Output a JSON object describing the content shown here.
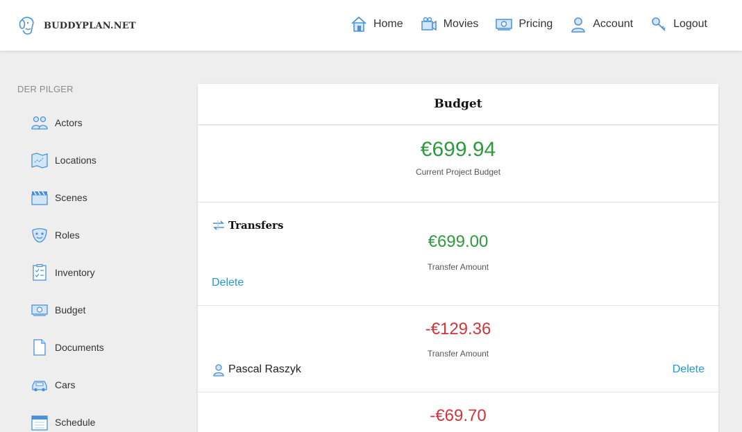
{
  "brand": {
    "name": "BUDDYPLAN.NET"
  },
  "nav": {
    "items": [
      {
        "label": "Home",
        "icon": "home-icon"
      },
      {
        "label": "Movies",
        "icon": "movie-camera-icon"
      },
      {
        "label": "Pricing",
        "icon": "money-icon"
      },
      {
        "label": "Account",
        "icon": "user-icon"
      },
      {
        "label": "Logout",
        "icon": "key-icon"
      }
    ]
  },
  "sidebar": {
    "title": "DER PILGER",
    "items": [
      {
        "label": "Actors",
        "icon": "actors-icon"
      },
      {
        "label": "Locations",
        "icon": "map-icon"
      },
      {
        "label": "Scenes",
        "icon": "clapperboard-icon"
      },
      {
        "label": "Roles",
        "icon": "mask-icon"
      },
      {
        "label": "Inventory",
        "icon": "checklist-icon"
      },
      {
        "label": "Budget",
        "icon": "money-icon"
      },
      {
        "label": "Documents",
        "icon": "document-icon"
      },
      {
        "label": "Cars",
        "icon": "car-icon"
      },
      {
        "label": "Schedule",
        "icon": "calendar-icon"
      }
    ]
  },
  "budget": {
    "title": "Budget",
    "current_amount": "€699.94",
    "current_label": "Current Project Budget",
    "entries": [
      {
        "title": "Transfers",
        "amount": "€699.00",
        "amount_label": "Transfer Amount",
        "delete_label": "Delete"
      },
      {
        "amount": "-€129.36",
        "amount_label": "Transfer Amount",
        "person": "Pascal Raszyk",
        "delete_label": "Delete"
      },
      {
        "amount": "-€69.70"
      }
    ]
  },
  "colors": {
    "positive": "#2e9a3e",
    "negative": "#d0343b",
    "link": "#1e9cd6"
  }
}
